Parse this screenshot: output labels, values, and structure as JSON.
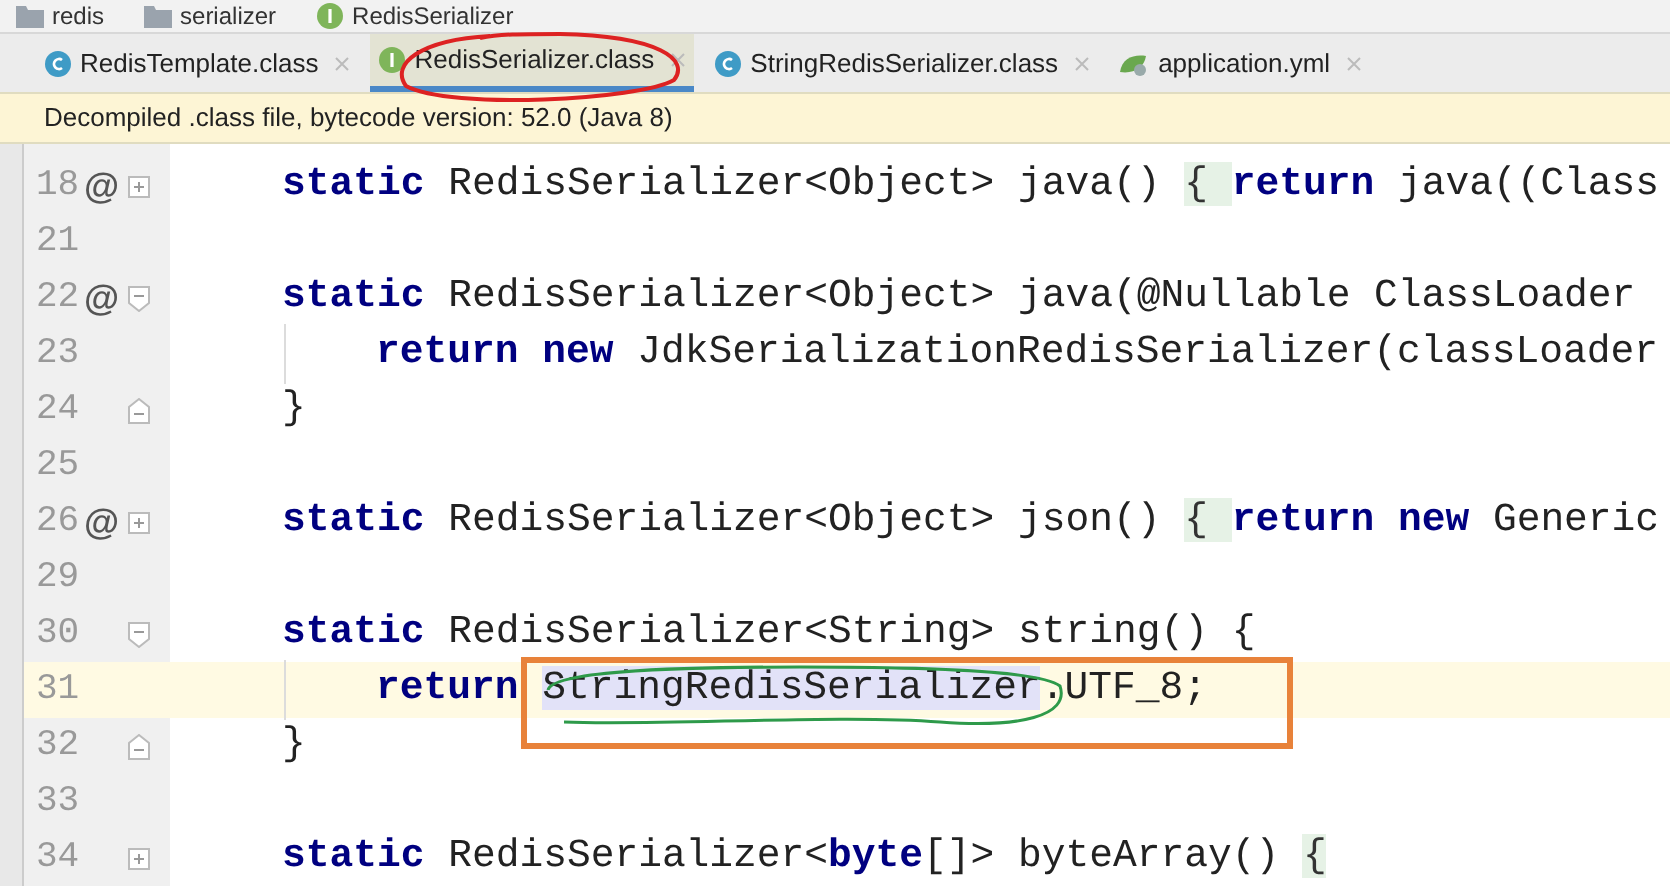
{
  "breadcrumb": [
    {
      "label": "redis",
      "kind": "folder"
    },
    {
      "label": "serializer",
      "kind": "folder"
    },
    {
      "label": "RedisSerializer",
      "kind": "interface"
    }
  ],
  "tabs": [
    {
      "label": "RedisTemplate.class",
      "kind": "class",
      "selected": false
    },
    {
      "label": "RedisSerializer.class",
      "kind": "interface",
      "selected": true
    },
    {
      "label": "StringRedisSerializer.class",
      "kind": "class",
      "selected": false
    },
    {
      "label": "application.yml",
      "kind": "yaml",
      "selected": false
    }
  ],
  "banner": "Decompiled .class file, bytecode version: 52.0 (Java 8)",
  "lines": [
    {
      "number": "18",
      "marker": "@",
      "fold": {
        "kind": "plus"
      },
      "current": false,
      "inner": false,
      "segments": [
        {
          "kind": "keyword",
          "text": "static"
        },
        {
          "kind": "plain",
          "text": " RedisSerializer<Object> java() "
        },
        {
          "kind": "brace",
          "text": "{ "
        },
        {
          "kind": "keyword",
          "text": "return"
        },
        {
          "kind": "plain",
          "text": " java((Class"
        }
      ]
    },
    {
      "number": "21",
      "current": false
    },
    {
      "number": "22",
      "marker": "@",
      "fold": {
        "kind": "open"
      },
      "current": false,
      "inner": false,
      "segments": [
        {
          "kind": "keyword",
          "text": "static"
        },
        {
          "kind": "plain",
          "text": " RedisSerializer<Object> java(@Nullable ClassLoader"
        }
      ]
    },
    {
      "number": "23",
      "current": false,
      "inner": true,
      "segments": [
        {
          "kind": "keyword",
          "text": "return new"
        },
        {
          "kind": "plain",
          "text": " JdkSerializationRedisSerializer(classLoader"
        }
      ]
    },
    {
      "number": "24",
      "fold": {
        "kind": "close"
      },
      "current": false,
      "inner": false,
      "segments": [
        {
          "kind": "plain",
          "text": "}"
        }
      ]
    },
    {
      "number": "25",
      "current": false
    },
    {
      "number": "26",
      "marker": "@",
      "fold": {
        "kind": "plus"
      },
      "current": false,
      "inner": false,
      "segments": [
        {
          "kind": "keyword",
          "text": "static"
        },
        {
          "kind": "plain",
          "text": " RedisSerializer<Object> json() "
        },
        {
          "kind": "brace",
          "text": "{ "
        },
        {
          "kind": "keyword",
          "text": "return new"
        },
        {
          "kind": "plain",
          "text": " Generic"
        }
      ]
    },
    {
      "number": "29",
      "current": false
    },
    {
      "number": "30",
      "fold": {
        "kind": "open"
      },
      "current": false,
      "inner": false,
      "segments": [
        {
          "kind": "keyword",
          "text": "static"
        },
        {
          "kind": "plain",
          "text": " RedisSerializer<String> string() {"
        }
      ]
    },
    {
      "number": "31",
      "current": true,
      "inner": true,
      "segments": [
        {
          "kind": "keyword",
          "text": "return "
        },
        {
          "kind": "usage",
          "text": "StringRedisSerializer"
        },
        {
          "kind": "plain",
          "text": ".UTF_8;"
        }
      ]
    },
    {
      "number": "32",
      "fold": {
        "kind": "close"
      },
      "current": false,
      "inner": false,
      "segments": [
        {
          "kind": "plain",
          "text": "}"
        }
      ]
    },
    {
      "number": "33",
      "current": false
    },
    {
      "number": "34",
      "fold": {
        "kind": "plus"
      },
      "current": false,
      "inner": false,
      "segments": [
        {
          "kind": "keyword",
          "text": "static"
        },
        {
          "kind": "plain",
          "text": " RedisSerializer<"
        },
        {
          "kind": "keyword",
          "text": "byte"
        },
        {
          "kind": "plain",
          "text": "[]> byteArray() "
        },
        {
          "kind": "brace",
          "text": "{"
        }
      ]
    }
  ]
}
